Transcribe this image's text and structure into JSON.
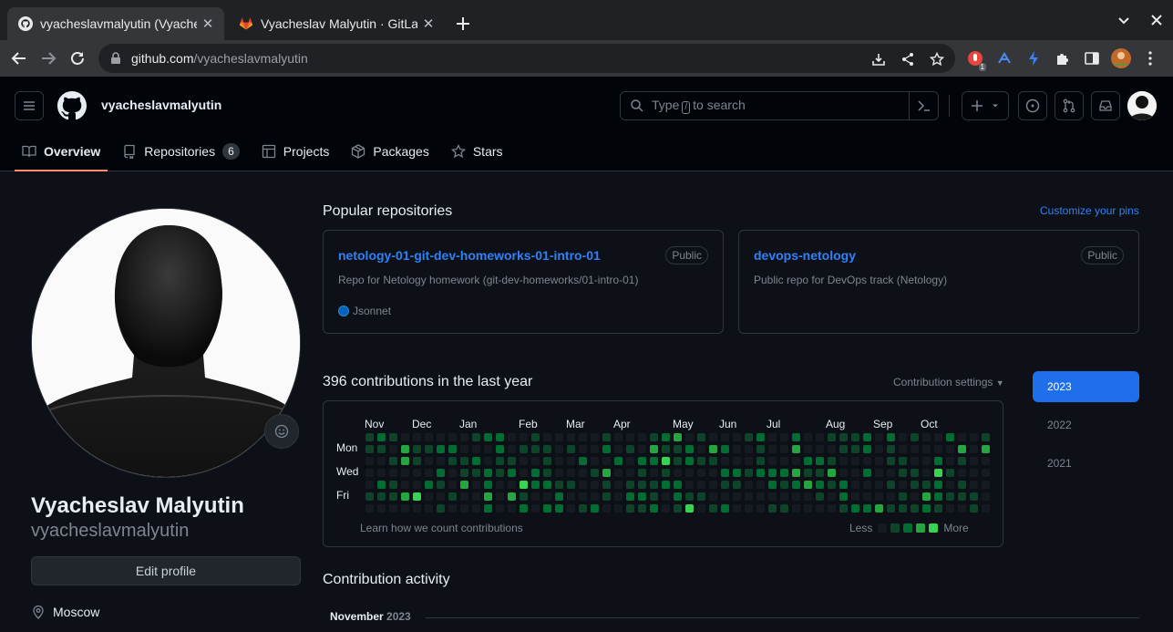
{
  "browser": {
    "tabs": [
      {
        "title": "vyacheslavmalyutin (Vyacheslav Malyutin)",
        "icon": "github-icon",
        "active": true
      },
      {
        "title": "Vyacheslav Malyutin · GitLab",
        "icon": "gitlab-icon",
        "active": false
      }
    ],
    "url_host": "github.com",
    "url_path": "/vyacheslavmalyutin",
    "extension_badge": "1"
  },
  "header": {
    "username": "vyacheslavmalyutin",
    "search": {
      "prefix": "Type",
      "key": "/",
      "suffix": "to search"
    }
  },
  "profile_tabs": [
    {
      "label": "Overview",
      "icon": "book-icon",
      "selected": true
    },
    {
      "label": "Repositories",
      "icon": "repo-icon",
      "count": "6"
    },
    {
      "label": "Projects",
      "icon": "table-icon"
    },
    {
      "label": "Packages",
      "icon": "package-icon"
    },
    {
      "label": "Stars",
      "icon": "star-icon"
    }
  ],
  "sidebar": {
    "name": "Vyacheslav Malyutin",
    "login": "vyacheslavmalyutin",
    "edit_button": "Edit profile",
    "location": "Moscow"
  },
  "popular": {
    "title": "Popular repositories",
    "customize": "Customize your pins",
    "repos": [
      {
        "name": "netology-01-git-dev-homeworks-01-intro-01",
        "visibility": "Public",
        "description": "Repo for Netology homework (git-dev-homeworks/01-intro-01)",
        "language": "Jsonnet",
        "language_color": "#0064bd"
      },
      {
        "name": "devops-netology",
        "visibility": "Public",
        "description": "Public repo for DevOps track (Netology)"
      }
    ]
  },
  "contributions": {
    "title": "396 contributions in the last year",
    "settings": "Contribution settings",
    "months": [
      "Nov",
      "Dec",
      "Jan",
      "Feb",
      "Mar",
      "Apr",
      "May",
      "Jun",
      "Jul",
      "Aug",
      "Sep",
      "Oct"
    ],
    "days": [
      "Mon",
      "Wed",
      "Fri"
    ],
    "learn": "Learn how we count contributions",
    "less": "Less",
    "more": "More",
    "levels": [
      "#161b22",
      "#0e4429",
      "#006d32",
      "#26a641",
      "#39d353"
    ]
  },
  "years": [
    {
      "label": "2023",
      "selected": true
    },
    {
      "label": "2022"
    },
    {
      "label": "2021"
    }
  ],
  "activity": {
    "title": "Contribution activity",
    "month": "November",
    "year": "2023"
  }
}
